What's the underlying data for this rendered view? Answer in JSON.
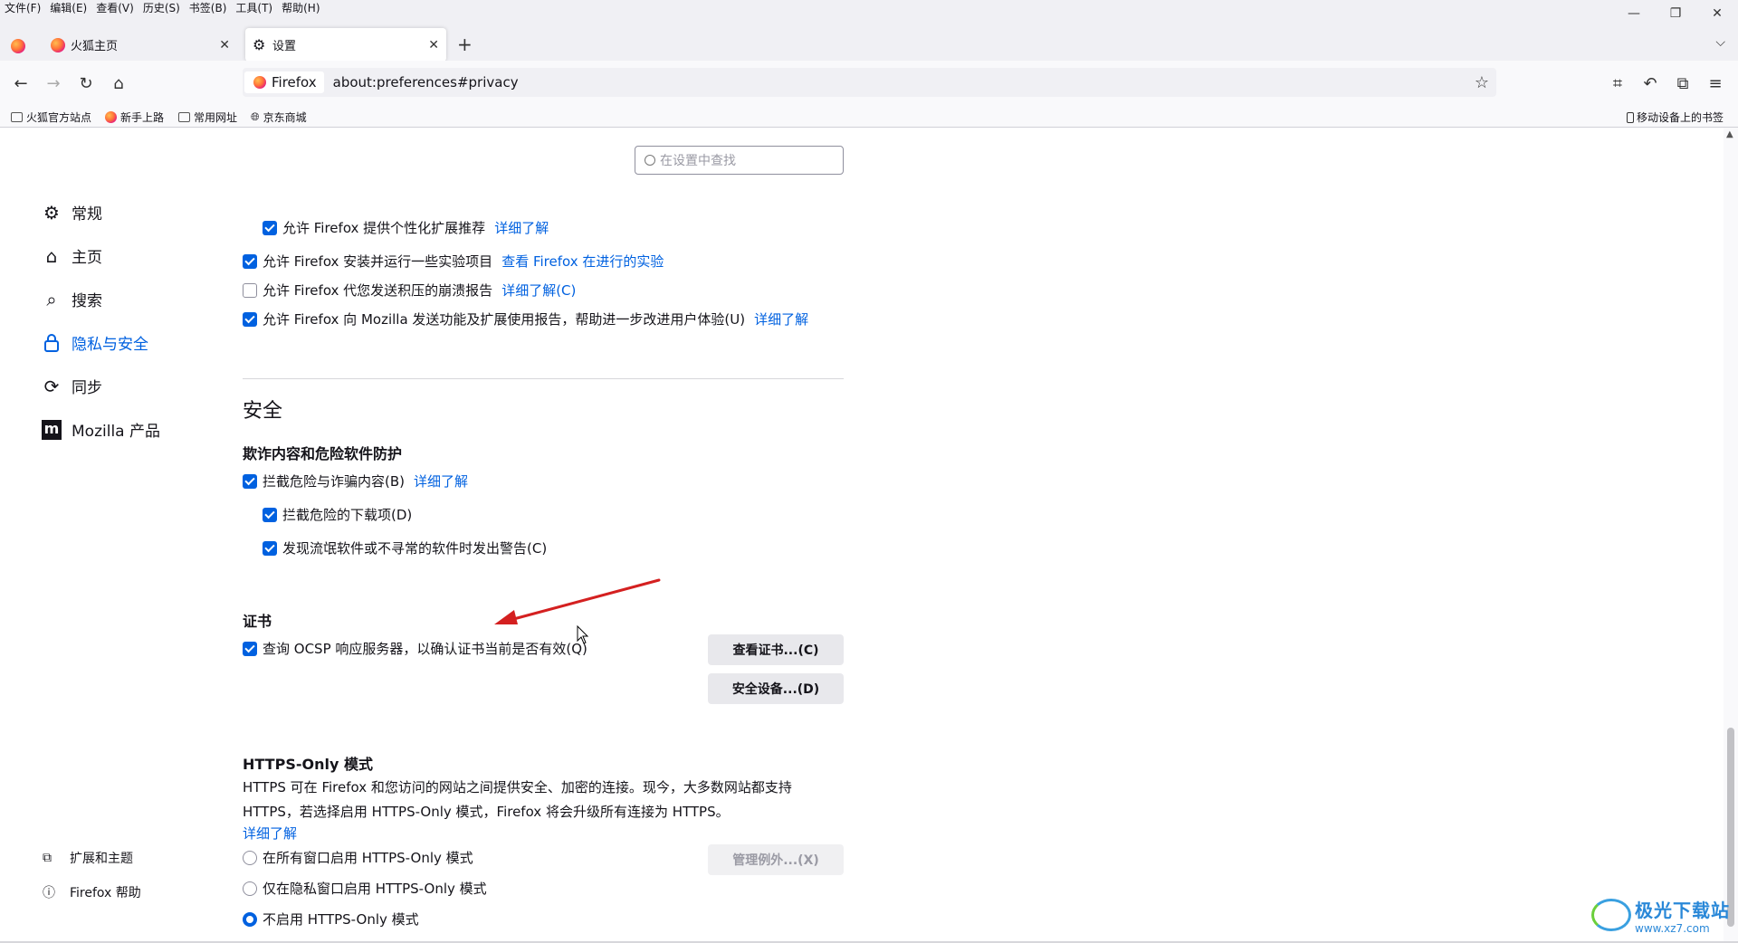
{
  "menubar": [
    "文件(F)",
    "编辑(E)",
    "查看(V)",
    "历史(S)",
    "书签(B)",
    "工具(T)",
    "帮助(H)"
  ],
  "tabs": [
    {
      "label": "火狐主页",
      "active": false
    },
    {
      "label": "设置",
      "active": true
    }
  ],
  "urlbar": {
    "identity": "Firefox",
    "url": "about:preferences#privacy"
  },
  "bookmarks": {
    "items": [
      "火狐官方站点",
      "新手上路",
      "常用网址",
      "京东商城"
    ],
    "mobile": "移动设备上的书签"
  },
  "search": {
    "placeholder": "在设置中查找"
  },
  "sidebar": {
    "categories": [
      "常规",
      "主页",
      "搜索",
      "隐私与安全",
      "同步",
      "Mozilla 产品"
    ],
    "selected": "隐私与安全",
    "footer": [
      "扩展和主题",
      "Firefox 帮助"
    ]
  },
  "data_collection": {
    "items": [
      {
        "label": "允许 Firefox 提供个性化扩展推荐",
        "checked": true,
        "link": "详细了解"
      },
      {
        "label": "允许 Firefox 安装并运行一些实验项目",
        "checked": true,
        "link": "查看 Firefox 在进行的实验"
      },
      {
        "label": "允许 Firefox 代您发送积压的崩溃报告",
        "checked": false,
        "link": "详细了解(C)"
      },
      {
        "label": "允许 Firefox 向 Mozilla 发送功能及扩展使用报告，帮助进一步改进用户体验(U)",
        "checked": true,
        "link": "详细了解"
      }
    ]
  },
  "security": {
    "title": "安全",
    "phishing": {
      "heading": "欺诈内容和危险软件防护",
      "block_label": "拦截危险与诈骗内容(B)",
      "block_link": "详细了解",
      "downloads_label": "拦截危险的下载项(D)",
      "uncommon_label": "发现流氓软件或不寻常的软件时发出警告(C)"
    },
    "certificates": {
      "heading": "证书",
      "ocsp_label": "查询 OCSP 响应服务器，以确认证书当前是否有效(Q)",
      "view_button": "查看证书...(C)",
      "devices_button": "安全设备...(D)"
    },
    "https_only": {
      "heading": "HTTPS-Only 模式",
      "description": "HTTPS 可在 Firefox 和您访问的网站之间提供安全、加密的连接。现今，大多数网站都支持 HTTPS，若选择启用 HTTPS-Only 模式，Firefox 将会升级所有连接为 HTTPS。",
      "learn_more": "详细了解",
      "options": [
        {
          "label": "在所有窗口启用 HTTPS-Only 模式",
          "selected": false
        },
        {
          "label": "仅在隐私窗口启用 HTTPS-Only 模式",
          "selected": false
        },
        {
          "label": "不启用 HTTPS-Only 模式",
          "selected": true
        }
      ],
      "exceptions_button": "管理例外...(X)"
    }
  },
  "watermark": {
    "name": "极光下载站",
    "url": "www.xz7.com"
  },
  "colors": {
    "accent": "#0061e0",
    "arrow": "#d42020"
  }
}
